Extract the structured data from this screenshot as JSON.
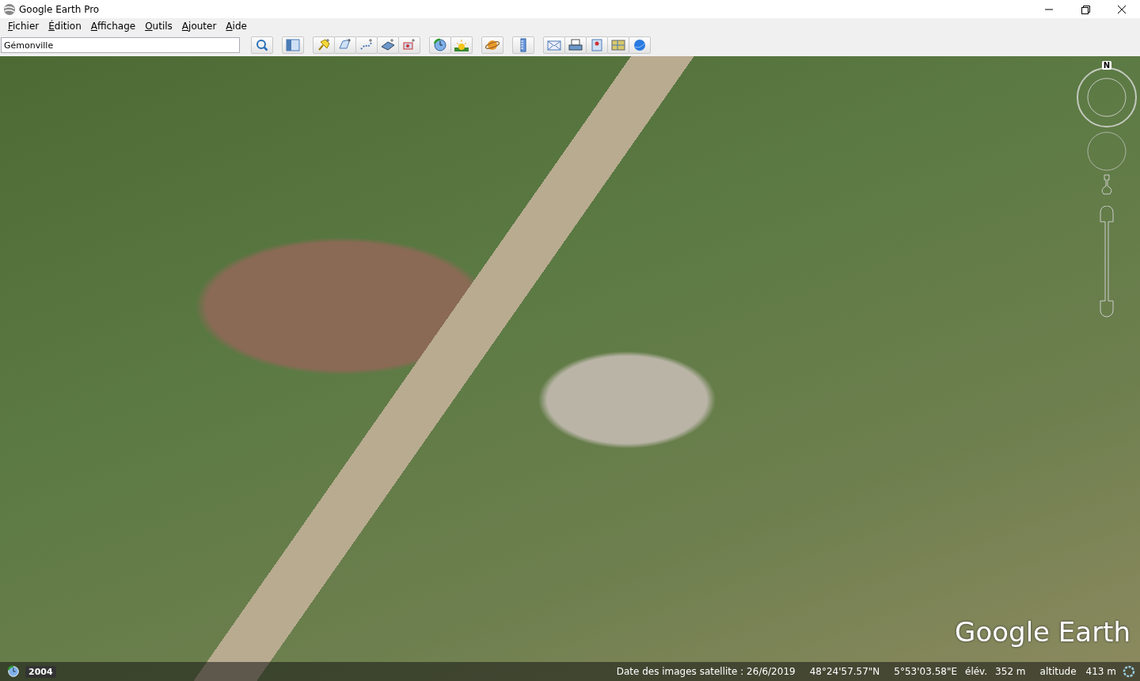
{
  "window": {
    "title": "Google Earth Pro"
  },
  "menu": [
    "Fichier",
    "Édition",
    "Affichage",
    "Outils",
    "Ajouter",
    "Aide"
  ],
  "search": {
    "value": "Gémonville"
  },
  "map": {
    "logo": "Google Earth",
    "compass_label": "N",
    "timeline_year": "2004"
  },
  "status_bar": {
    "imagery_date": "Date des images satellite : 26/6/2019",
    "latitude": "48°24'57.57\"N",
    "longitude": "5°53'03.58\"E",
    "elevation_label": "élév.",
    "elevation": "352 m",
    "altitude_label": "altitude",
    "altitude": "413 m"
  }
}
